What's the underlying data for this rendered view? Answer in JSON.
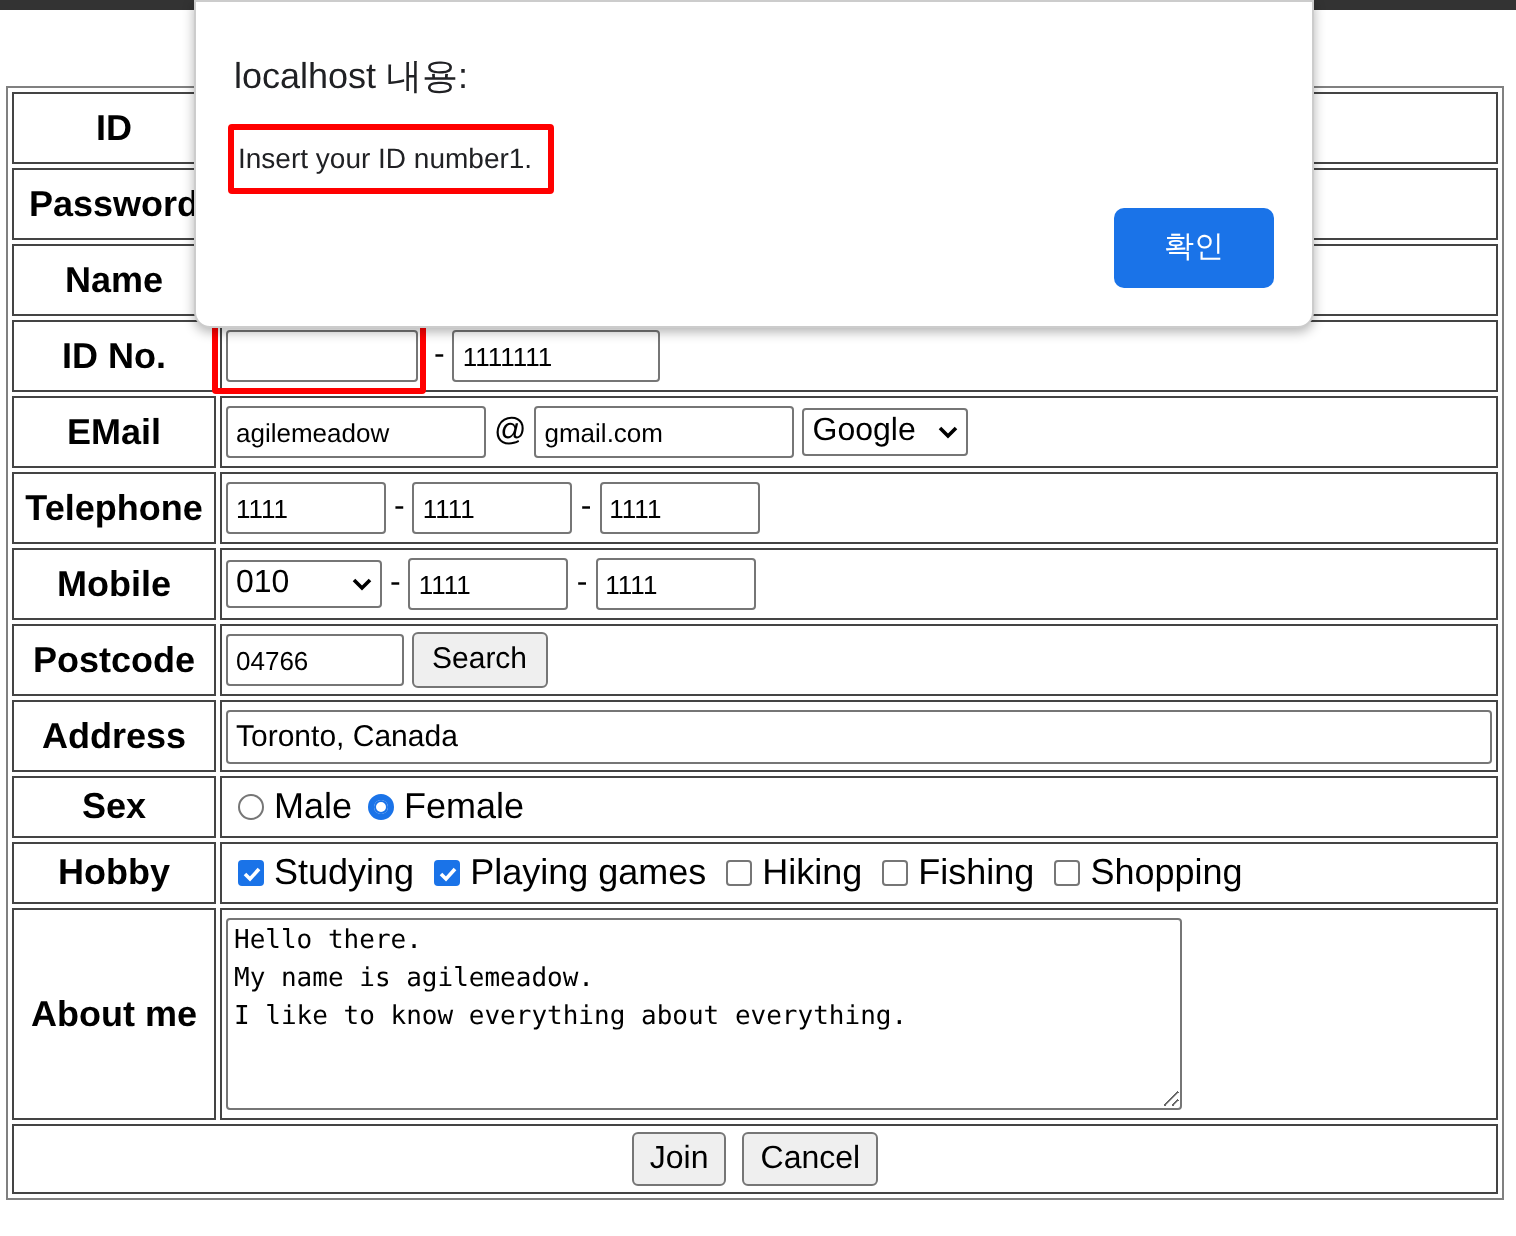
{
  "dialog": {
    "title": "localhost 내용:",
    "message": "Insert your ID number1.",
    "message_highlighted": true,
    "button": "확인"
  },
  "form": {
    "rows": [
      {
        "label": "ID"
      },
      {
        "label": "Password"
      },
      {
        "label": "Name"
      },
      {
        "label": "ID No.",
        "controls": [
          {
            "kind": "field",
            "highlighted": true
          },
          {
            "kind": "text",
            "text": "-"
          },
          {
            "kind": "field",
            "value": "1111111",
            "highlighted": false
          }
        ]
      },
      {
        "label": "EMail",
        "controls": [
          {
            "kind": "field",
            "value": "agilemeadow",
            "highlighted": false
          },
          {
            "kind": "text",
            "text": "@"
          },
          {
            "kind": "field",
            "value": "gmail.com",
            "highlighted": false
          },
          {
            "kind": "select",
            "value": "Google"
          }
        ]
      },
      {
        "label": "Telephone",
        "controls": [
          {
            "kind": "field",
            "value": "1111",
            "highlighted": false
          },
          {
            "kind": "text",
            "text": "-"
          },
          {
            "kind": "field",
            "value": "1111",
            "highlighted": false
          },
          {
            "kind": "text",
            "text": "-"
          },
          {
            "kind": "field",
            "value": "1111",
            "highlighted": false
          }
        ]
      },
      {
        "label": "Mobile",
        "controls": [
          {
            "kind": "select",
            "value": "010"
          },
          {
            "kind": "text",
            "text": "-"
          },
          {
            "kind": "field",
            "value": "1111",
            "highlighted": false
          },
          {
            "kind": "text",
            "text": "-"
          },
          {
            "kind": "field",
            "value": "1111",
            "highlighted": false
          }
        ]
      },
      {
        "label": "Postcode",
        "controls": [
          {
            "kind": "field",
            "value": "04766",
            "highlighted": false
          },
          {
            "kind": "button",
            "text": "Search"
          }
        ]
      },
      {
        "label": "Address",
        "controls": [
          {
            "kind": "wide-field",
            "value": "Toronto, Canada"
          }
        ]
      },
      {
        "label": "Sex",
        "controls": [
          {
            "kind": "radio",
            "text": "Male",
            "selected": false
          },
          {
            "kind": "radio",
            "text": "Female",
            "selected": true
          }
        ]
      },
      {
        "label": "Hobby",
        "controls": [
          {
            "kind": "checkbox",
            "text": "Studying",
            "checked": true
          },
          {
            "kind": "checkbox",
            "text": "Playing games",
            "checked": true
          },
          {
            "kind": "checkbox",
            "text": "Hiking",
            "checked": false
          },
          {
            "kind": "checkbox",
            "text": "Fishing",
            "checked": false
          },
          {
            "kind": "checkbox",
            "text": "Shopping",
            "checked": false
          }
        ]
      },
      {
        "label": "About me",
        "controls": [
          {
            "kind": "textarea",
            "value": "Hello there.\nMy name is agilemeadow.\nI like to know everything about everything."
          }
        ]
      }
    ],
    "buttons": [
      "Join",
      "Cancel"
    ]
  }
}
